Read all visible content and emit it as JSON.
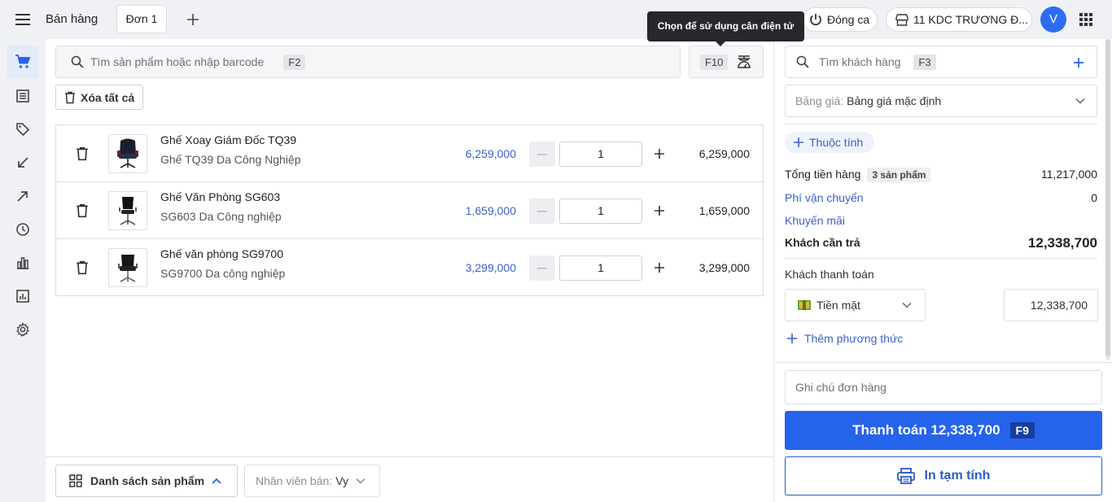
{
  "header": {
    "app_title": "Bán hàng",
    "active_tab": "Đơn 1",
    "close_shift_label": "Đóng ca",
    "store_label": "11 KDC TRƯƠNG Đ...",
    "avatar_initial": "V",
    "tooltip": "Chọn để sử dụng cân điện tử"
  },
  "sidebar": {
    "items": [
      {
        "icon": "cart-icon",
        "active": true
      },
      {
        "icon": "list-icon"
      },
      {
        "icon": "tag-icon"
      },
      {
        "icon": "arrow-down-left-icon"
      },
      {
        "icon": "arrow-up-right-icon"
      },
      {
        "icon": "clock-icon"
      },
      {
        "icon": "bar-chart-icon"
      },
      {
        "icon": "report-icon"
      },
      {
        "icon": "gear-icon"
      }
    ]
  },
  "main": {
    "search_placeholder": "Tìm sản phẩm hoặc nhập barcode",
    "search_shortcut": "F2",
    "scale_shortcut": "F10",
    "clear_all_label": "Xóa tất cả",
    "items": [
      {
        "name": "Ghế Xoay Giám Đốc TQ39",
        "sku": "Ghế TQ39 Da Công Nghiệp",
        "price": "6,259,000",
        "qty": "1",
        "total": "6,259,000"
      },
      {
        "name": "Ghế Văn Phòng SG603",
        "sku": "SG603 Da Công nghiệp",
        "price": "1,659,000",
        "qty": "1",
        "total": "1,659,000"
      },
      {
        "name": "Ghế văn phòng SG9700",
        "sku": "SG9700 Da công nghiệp",
        "price": "3,299,000",
        "qty": "1",
        "total": "3,299,000"
      }
    ],
    "product_list_label": "Danh sách sản phẩm",
    "staff_label": "Nhân viên bán:",
    "staff_value": "Vy"
  },
  "right": {
    "customer_placeholder": "Tìm khách hàng",
    "customer_shortcut": "F3",
    "pricebook_label": "Bảng giá:",
    "pricebook_value": "Bảng giá mặc định",
    "attribute_label": "Thuộc tính",
    "subtotal_label": "Tổng tiền hàng",
    "subtotal_badge": "3 sản phẩm",
    "subtotal_value": "11,217,000",
    "shipping_label": "Phí vận chuyển",
    "shipping_value": "0",
    "promo_label": "Khuyến mãi",
    "due_label": "Khách cần trả",
    "due_value": "12,338,700",
    "payment_label": "Khách thanh toán",
    "method_value": "Tiền mặt",
    "payment_amount": "12,338,700",
    "add_method_label": "Thêm phương thức",
    "note_placeholder": "Ghi chú đơn hàng",
    "pay_button_label": "Thanh toán 12,338,700",
    "pay_shortcut": "F9",
    "print_label": "In tạm tính"
  },
  "colors": {
    "accent": "#2563eb",
    "link": "#3a63c7",
    "tooltip_bg": "#27282c"
  }
}
